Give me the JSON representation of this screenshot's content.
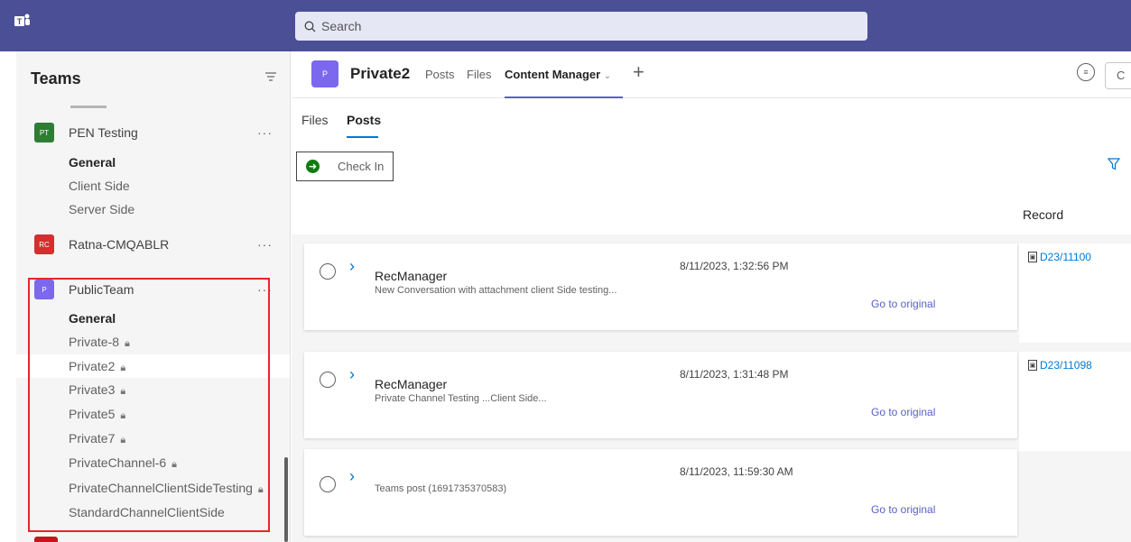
{
  "topbar": {
    "search_placeholder": "Search"
  },
  "sidebar": {
    "title": "Teams",
    "teams": [
      {
        "initials": "PT",
        "name": "PEN Testing",
        "color": "#2e7d32"
      },
      {
        "initials": "RC",
        "name": "Ratna-CMQABLR",
        "color": "#d32f2f"
      },
      {
        "initials": "P",
        "name": "PublicTeam",
        "color": "#7b68ee"
      }
    ],
    "pen_channels": [
      "General",
      "Client Side",
      "Server Side"
    ],
    "public_channels": [
      "General",
      "Private-8",
      "Private2",
      "Private3",
      "Private5",
      "Private7",
      "PrivateChannel-6",
      "PrivateChannelClientSideTesting",
      "StandardChannelClientSide"
    ],
    "more": "···"
  },
  "header": {
    "avatar": "P",
    "channel": "Private2",
    "tabs": [
      "Posts",
      "Files",
      "Content Manager"
    ],
    "plus": "+"
  },
  "content": {
    "subtabs": [
      "Files",
      "Posts"
    ],
    "checkin": "Check In",
    "record_header": "Record",
    "go_to_original": "Go to original",
    "posts": [
      {
        "author": "RecManager",
        "body": "New Conversation with attachment client Side testing...",
        "date": "8/11/2023, 1:32:56 PM",
        "record": "D23/11100"
      },
      {
        "author": "RecManager",
        "body": "Private Channel Testing ...Client Side...",
        "date": "8/11/2023, 1:31:48 PM",
        "record": "D23/11098"
      },
      {
        "author": "",
        "body": "Teams post (1691735370583)",
        "date": "8/11/2023, 11:59:30 AM",
        "record": ""
      }
    ]
  }
}
